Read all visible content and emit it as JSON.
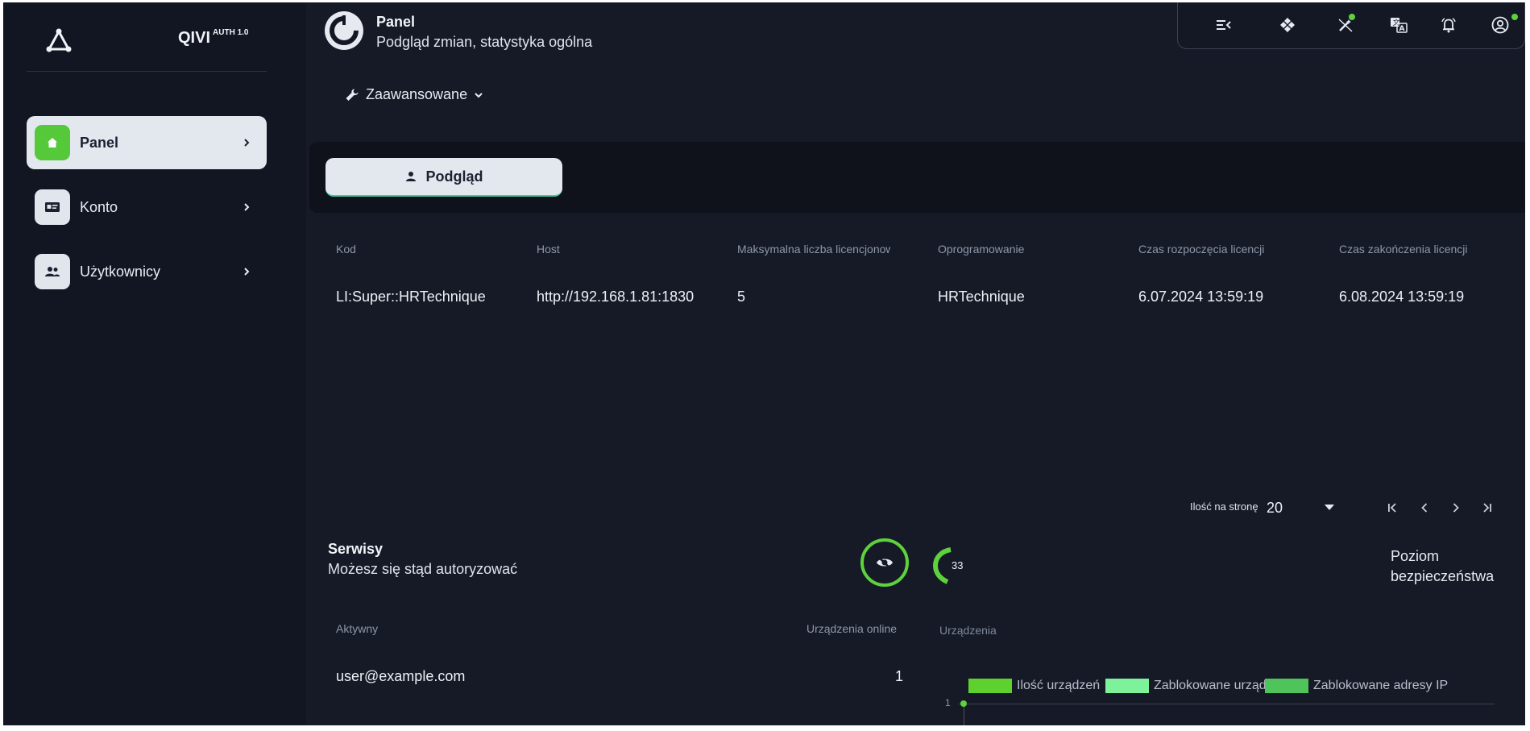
{
  "sidebar": {
    "brand": "QIVI",
    "brand_sup": "AUTH 1.0",
    "items": [
      {
        "label": "Panel",
        "active": true,
        "icon": "home-icon"
      },
      {
        "label": "Konto",
        "active": false,
        "icon": "id-card-icon"
      },
      {
        "label": "Użytkownicy",
        "active": false,
        "icon": "users-icon"
      }
    ]
  },
  "header": {
    "title": "Panel",
    "subtitle": "Podgląd zmian, statystyka ogólna"
  },
  "toolbar": {
    "icons": [
      "menu-collapse-icon",
      "diamond-grid-icon",
      "magic-wand-icon",
      "translate-icon",
      "bell-icon",
      "account-circle-icon"
    ]
  },
  "advanced": {
    "label": "Zaawansowane"
  },
  "tabs": [
    {
      "label": "Podgląd",
      "active": true
    }
  ],
  "table": {
    "columns": [
      "Kod",
      "Host",
      "Maksymalna liczba licencjonowanych",
      "Oprogramowanie",
      "Czas rozpoczęcia licencji",
      "Czas zakończenia licencji"
    ],
    "rows": [
      [
        "LI:Super::HRTechnique",
        "http://192.168.1.81:1830",
        "5",
        "HRTechnique",
        "6.07.2024 13:59:19",
        "6.08.2024 13:59:19"
      ]
    ]
  },
  "pagination": {
    "per_page_label": "Ilość na stronę",
    "per_page_value": "20"
  },
  "services": {
    "title": "Serwisy",
    "subtitle": "Możesz się stąd autoryzować",
    "gauge_value": "33",
    "security_label": "Poziom bezpieczeństwa"
  },
  "sessions": {
    "columns": [
      "Aktywny",
      "Urządzenia online"
    ],
    "rows": [
      [
        "user@example.com",
        "1"
      ]
    ]
  },
  "devices_chart": {
    "title": "Urządzenia",
    "legend": [
      "Ilość urządzeń",
      "Zablokowane urządzenia",
      "Zablokowane adresy IP"
    ],
    "y_tick": "1"
  },
  "colors": {
    "accent": "#55c93a",
    "legend": [
      "#5fd12e",
      "#7ef29a",
      "#4fc45a"
    ]
  }
}
